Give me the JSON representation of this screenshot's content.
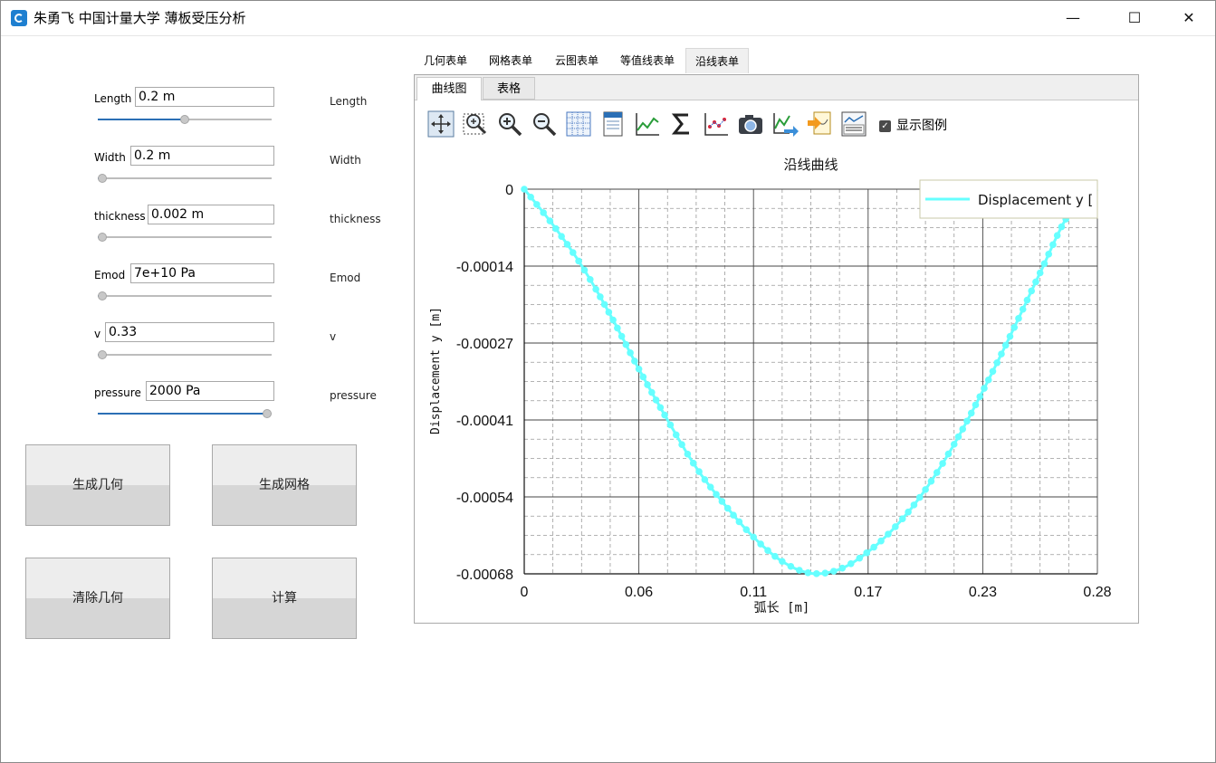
{
  "window": {
    "title": "朱勇飞 中国计量大学 薄板受压分析",
    "minimize_glyph": "—",
    "maximize_glyph": "☐",
    "close_glyph": "✕"
  },
  "params": [
    {
      "label": "Length",
      "value": "0.2 m",
      "side": "Length",
      "slider": 0.5
    },
    {
      "label": "Width",
      "value": "0.2 m",
      "side": "Width",
      "slider": 0.0
    },
    {
      "label": "thickness",
      "value": "0.002 m",
      "side": "thickness",
      "slider": 0.0
    },
    {
      "label": "Emod",
      "value": "7e+10 Pa",
      "side": "Emod",
      "slider": 0.0
    },
    {
      "label": "v",
      "value": "0.33",
      "side": "v",
      "slider": 0.0
    },
    {
      "label": "pressure",
      "value": "2000 Pa",
      "side": "pressure",
      "slider": 1.0
    }
  ],
  "buttons": {
    "gen_geometry": "生成几何",
    "gen_mesh": "生成网格",
    "clear_geometry": "清除几何",
    "compute": "计算"
  },
  "tabs": [
    "几何表单",
    "网格表单",
    "云图表单",
    "等值线表单",
    "沿线表单"
  ],
  "active_tab": 4,
  "subtabs": [
    "曲线图",
    "表格"
  ],
  "toolbar": {
    "icons": [
      "pan-icon",
      "zoom-box-icon",
      "zoom-in-icon",
      "zoom-out-icon",
      "grid-icon",
      "page-icon",
      "line-chart-icon",
      "sum-icon",
      "scatter-icon",
      "camera-icon",
      "export-curve-icon",
      "import-icon",
      "legend-icon"
    ],
    "show_legend_label": "显示图例"
  },
  "chart_data": {
    "type": "line",
    "title": "沿线曲线",
    "xlabel": "弧长 [m]",
    "ylabel": "Displacement y [m]",
    "xlim": [
      0,
      0.28
    ],
    "ylim": [
      -0.00068,
      0
    ],
    "xticks": [
      "0",
      "0.06",
      "0.11",
      "0.17",
      "0.23",
      "0.28"
    ],
    "yticks": [
      "0",
      "-0.00014",
      "-0.00027",
      "-0.00041",
      "-0.00054",
      "-0.00068"
    ],
    "grid": true,
    "legend_position": "top-right",
    "series": [
      {
        "name": "Displacement y [m]",
        "color": "#66ffff",
        "x": [
          0,
          0.014,
          0.028,
          0.042,
          0.056,
          0.07,
          0.084,
          0.098,
          0.112,
          0.126,
          0.14,
          0.154,
          0.168,
          0.182,
          0.196,
          0.21,
          0.224,
          0.238,
          0.252,
          0.266,
          0.28
        ],
        "y": [
          0,
          -6.3e-05,
          -0.000135,
          -0.000222,
          -0.000318,
          -0.000408,
          -0.000492,
          -0.000558,
          -0.000615,
          -0.000658,
          -0.000679,
          -0.000672,
          -0.000641,
          -0.000594,
          -0.000531,
          -0.000451,
          -0.000357,
          -0.000255,
          -0.000148,
          -4.5e-05,
          0
        ]
      }
    ]
  }
}
